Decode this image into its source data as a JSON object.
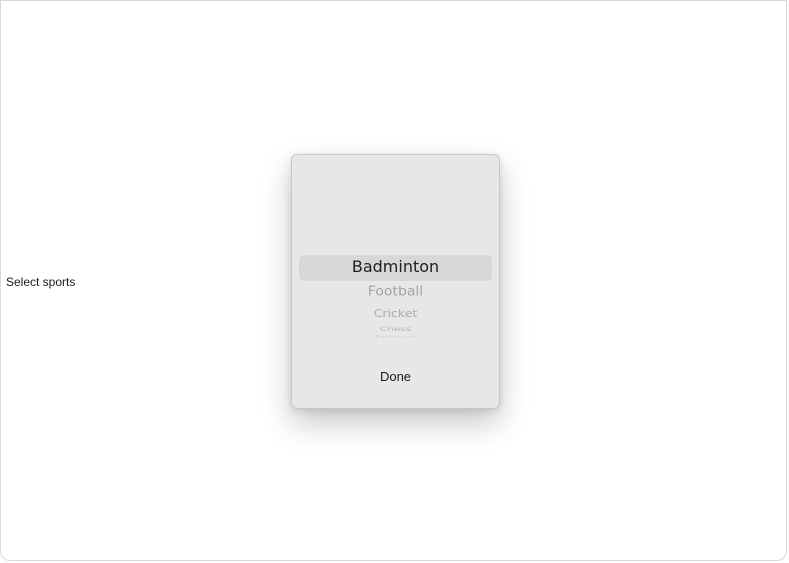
{
  "form": {
    "label": "Select sports"
  },
  "picker": {
    "selected": "Badminton",
    "items": [
      "Badminton",
      "Football",
      "Cricket",
      "Chess",
      "Basketball"
    ],
    "done_label": "Done"
  }
}
